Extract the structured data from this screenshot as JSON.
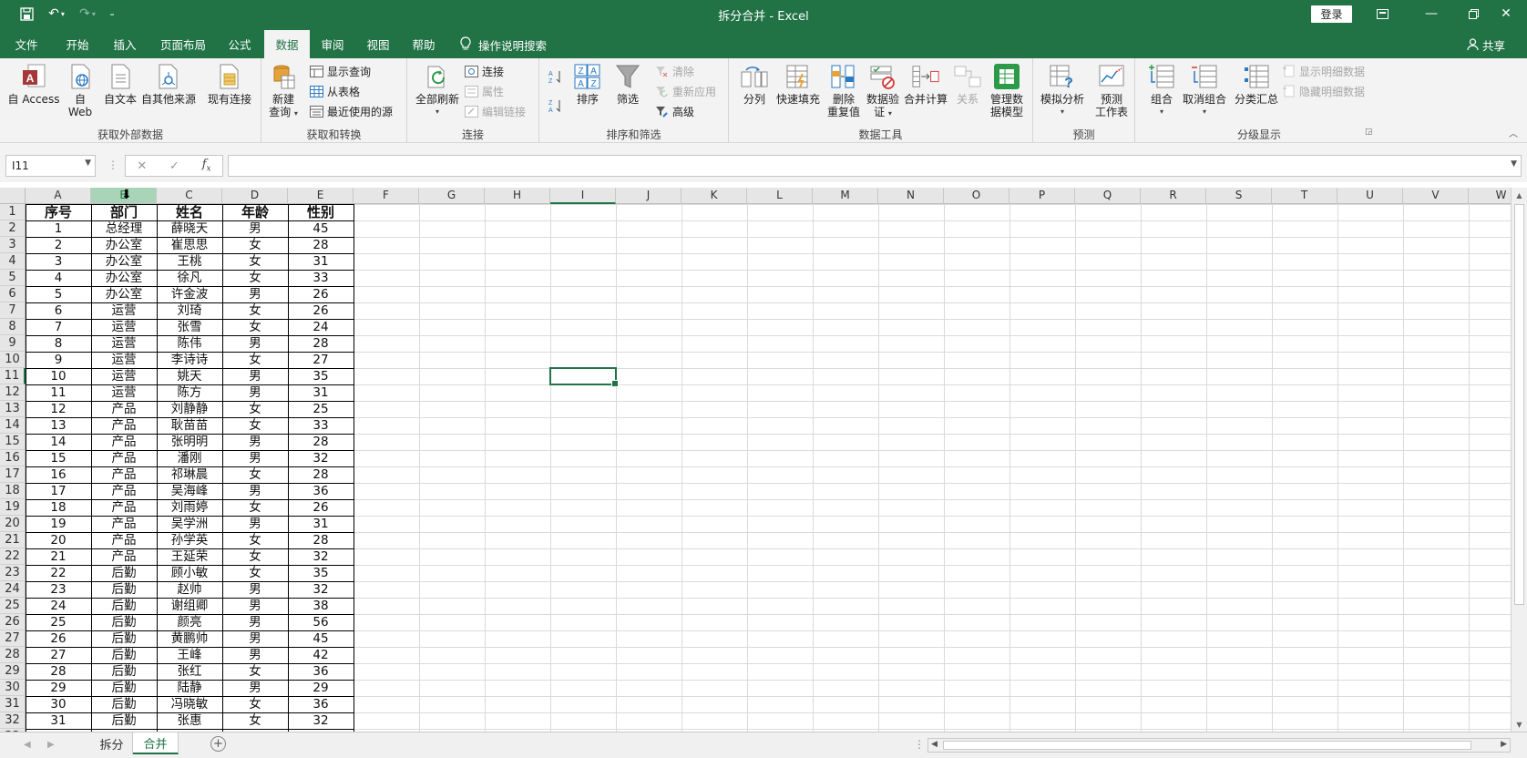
{
  "window": {
    "title": "拆分合并  -  Excel",
    "login_label": "登录"
  },
  "ribbon_tabs": [
    {
      "label": "文件"
    },
    {
      "label": "开始"
    },
    {
      "label": "插入"
    },
    {
      "label": "页面布局"
    },
    {
      "label": "公式"
    },
    {
      "label": "数据"
    },
    {
      "label": "审阅"
    },
    {
      "label": "视图"
    },
    {
      "label": "帮助"
    }
  ],
  "active_tab": "数据",
  "tell_me": "操作说明搜索",
  "share": "共享",
  "groups": {
    "get_external": {
      "label": "获取外部数据",
      "access": "自 Access",
      "web_1": "自",
      "web_2": "Web",
      "text": "自文本",
      "other": "自其他来源",
      "existing": "现有连接"
    },
    "get_transform": {
      "label": "获取和转换",
      "new_query_1": "新建",
      "new_query_2": "查询",
      "show_queries": "显示查询",
      "from_table": "从表格",
      "recent_sources": "最近使用的源"
    },
    "connections": {
      "label": "连接",
      "refresh_all": "全部刷新",
      "connections": "连接",
      "properties": "属性",
      "edit_links": "编辑链接"
    },
    "sort_filter": {
      "label": "排序和筛选",
      "sort": "排序",
      "filter": "筛选",
      "clear": "清除",
      "reapply": "重新应用",
      "advanced": "高级"
    },
    "data_tools": {
      "label": "数据工具",
      "text_to_columns": "分列",
      "flash_fill": "快速填充",
      "remove_dup_1": "删除",
      "remove_dup_2": "重复值",
      "validation_1": "数据验",
      "validation_2": "证",
      "consolidate": "合并计算",
      "relationships": "关系",
      "data_model_1": "管理数",
      "data_model_2": "据模型"
    },
    "forecast": {
      "label": "预测",
      "what_if": "模拟分析",
      "sheet_1": "预测",
      "sheet_2": "工作表"
    },
    "outline": {
      "label": "分级显示",
      "group": "组合",
      "ungroup": "取消组合",
      "subtotal": "分类汇总",
      "show_detail": "显示明细数据",
      "hide_detail": "隐藏明细数据"
    }
  },
  "name_box": "I11",
  "formula": "",
  "columns": [
    "A",
    "B",
    "C",
    "D",
    "E",
    "F",
    "G",
    "H",
    "I",
    "J",
    "K",
    "L",
    "M",
    "N",
    "O",
    "P",
    "Q",
    "R",
    "S",
    "T",
    "U",
    "V",
    "W"
  ],
  "selected_column": "B",
  "active_cell": {
    "col": "I",
    "row": 11
  },
  "header_row": [
    "序号",
    "部门",
    "姓名",
    "年龄",
    "性别"
  ],
  "rows": [
    [
      "1",
      "总经理",
      "薛晓天",
      "男",
      "45"
    ],
    [
      "2",
      "办公室",
      "崔思思",
      "女",
      "28"
    ],
    [
      "3",
      "办公室",
      "王桃",
      "女",
      "31"
    ],
    [
      "4",
      "办公室",
      "徐凡",
      "女",
      "33"
    ],
    [
      "5",
      "办公室",
      "许金波",
      "男",
      "26"
    ],
    [
      "6",
      "运营",
      "刘琦",
      "女",
      "26"
    ],
    [
      "7",
      "运营",
      "张雪",
      "女",
      "24"
    ],
    [
      "8",
      "运营",
      "陈伟",
      "男",
      "28"
    ],
    [
      "9",
      "运营",
      "李诗诗",
      "女",
      "27"
    ],
    [
      "10",
      "运营",
      "姚天",
      "男",
      "35"
    ],
    [
      "11",
      "运营",
      "陈方",
      "男",
      "31"
    ],
    [
      "12",
      "产品",
      "刘静静",
      "女",
      "25"
    ],
    [
      "13",
      "产品",
      "耿苗苗",
      "女",
      "33"
    ],
    [
      "14",
      "产品",
      "张明明",
      "男",
      "28"
    ],
    [
      "15",
      "产品",
      "潘刚",
      "男",
      "32"
    ],
    [
      "16",
      "产品",
      "祁琳晨",
      "女",
      "28"
    ],
    [
      "17",
      "产品",
      "吴海峰",
      "男",
      "36"
    ],
    [
      "18",
      "产品",
      "刘雨婷",
      "女",
      "26"
    ],
    [
      "19",
      "产品",
      "吴学洲",
      "男",
      "31"
    ],
    [
      "20",
      "产品",
      "孙学英",
      "女",
      "28"
    ],
    [
      "21",
      "产品",
      "王延荣",
      "女",
      "32"
    ],
    [
      "22",
      "后勤",
      "顾小敏",
      "女",
      "35"
    ],
    [
      "23",
      "后勤",
      "赵帅",
      "男",
      "32"
    ],
    [
      "24",
      "后勤",
      "谢组卿",
      "男",
      "38"
    ],
    [
      "25",
      "后勤",
      "颜亮",
      "男",
      "56"
    ],
    [
      "26",
      "后勤",
      "黄鹏帅",
      "男",
      "45"
    ],
    [
      "27",
      "后勤",
      "王峰",
      "男",
      "42"
    ],
    [
      "28",
      "后勤",
      "张红",
      "女",
      "36"
    ],
    [
      "29",
      "后勤",
      "陆静",
      "男",
      "29"
    ],
    [
      "30",
      "后勤",
      "冯晓敏",
      "女",
      "36"
    ],
    [
      "31",
      "后勤",
      "张惠",
      "女",
      "32"
    ]
  ],
  "sheets": [
    {
      "label": "拆分"
    },
    {
      "label": "合并"
    }
  ],
  "active_sheet": "合并",
  "colors": {
    "accent": "#217346",
    "ribbon_bg": "#f3f3f3",
    "header_bg": "#e6e6e6"
  }
}
